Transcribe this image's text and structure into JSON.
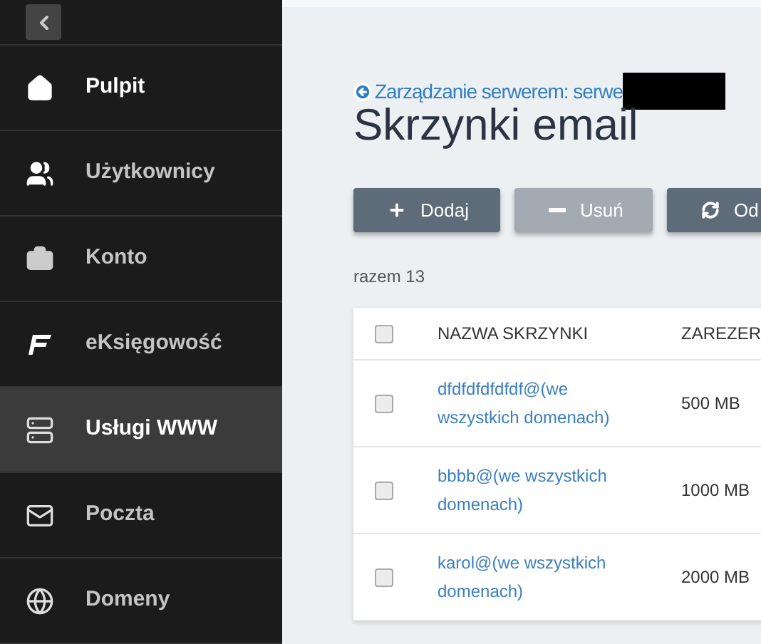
{
  "sidebar": {
    "items": [
      {
        "label": "Pulpit",
        "kind": "home",
        "selected": false,
        "active": true
      },
      {
        "label": "Użytkownicy",
        "kind": "users",
        "selected": false,
        "active": false
      },
      {
        "label": "Konto",
        "kind": "account",
        "selected": false,
        "active": false
      },
      {
        "label": "eKsięgowość",
        "kind": "accounting",
        "selected": false,
        "active": false
      },
      {
        "label": "Usługi WWW",
        "kind": "www",
        "selected": true,
        "active": true
      },
      {
        "label": "Poczta",
        "kind": "mail",
        "selected": false,
        "active": false
      },
      {
        "label": "Domeny",
        "kind": "domains",
        "selected": false,
        "active": false
      }
    ]
  },
  "breadcrumb": "Zarządzanie serwerem: serwe",
  "title": "Skrzynki email",
  "buttons": [
    {
      "label": "Dodaj",
      "kind": "add",
      "disabled": false
    },
    {
      "label": "Usuń",
      "kind": "remove",
      "disabled": true
    },
    {
      "label": "Od",
      "kind": "refresh",
      "disabled": false
    }
  ],
  "total": "razem 13",
  "table": {
    "columns": [
      "NAZWA SKRZYNKI",
      "ZAREZER"
    ],
    "header_checked": false,
    "rows": [
      {
        "name": "dfdfdfdfdfdf@(we wszystkich domenach)",
        "size": "500 MB",
        "checked": false
      },
      {
        "name": "bbbb@(we wszystkich domenach)",
        "size": "1000 MB",
        "checked": false
      },
      {
        "name": "karol@(we wszystkich domenach)",
        "size": "2000 MB",
        "checked": false
      }
    ]
  }
}
